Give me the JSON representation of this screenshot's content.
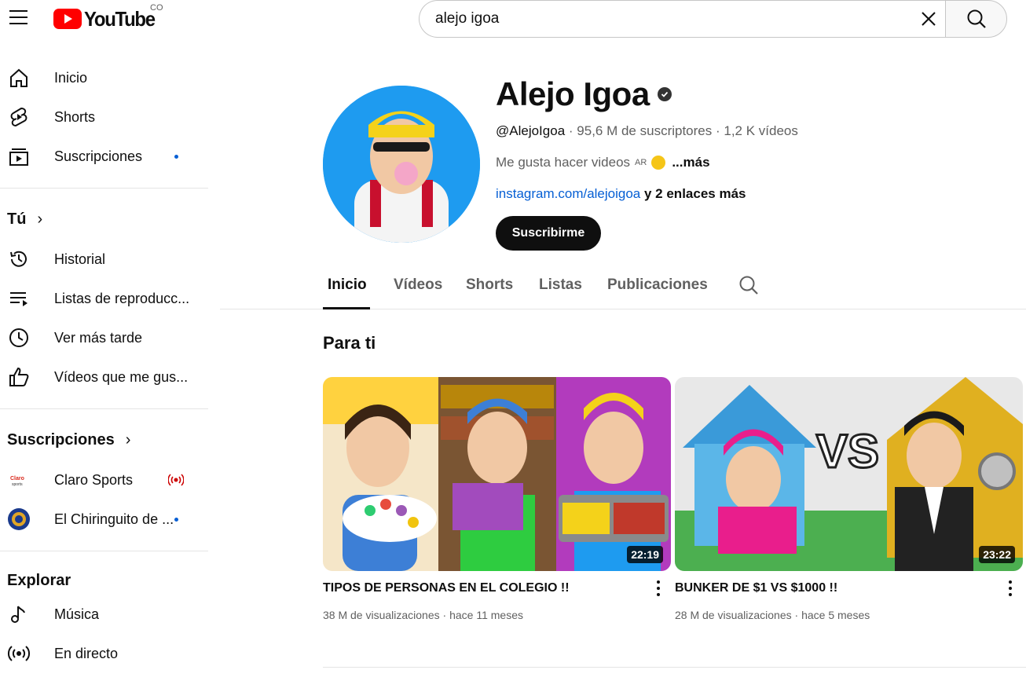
{
  "header": {
    "logo_text": "YouTube",
    "country_code": "CO",
    "search_value": "alejo igoa"
  },
  "sidebar": {
    "main": [
      {
        "label": "Inicio",
        "icon": "home-icon"
      },
      {
        "label": "Shorts",
        "icon": "shorts-icon"
      },
      {
        "label": "Suscripciones",
        "icon": "subscriptions-icon",
        "dot": true
      }
    ],
    "you_header": "Tú",
    "you": [
      {
        "label": "Historial",
        "icon": "history-icon"
      },
      {
        "label": "Listas de reproducc...",
        "icon": "playlists-icon"
      },
      {
        "label": "Ver más tarde",
        "icon": "watch-later-icon"
      },
      {
        "label": "Vídeos que me gus...",
        "icon": "liked-icon"
      }
    ],
    "subs_header": "Suscripciones",
    "subs": [
      {
        "label": "Claro Sports",
        "icon": "claro-sports-avatar",
        "live": true
      },
      {
        "label": "El Chiringuito de ...",
        "icon": "chiringuito-avatar",
        "dot": true
      }
    ],
    "explore_header": "Explorar",
    "explore": [
      {
        "label": "Música",
        "icon": "music-icon"
      },
      {
        "label": "En directo",
        "icon": "live-icon"
      }
    ]
  },
  "channel": {
    "name": "Alejo Igoa",
    "handle": "@AlejoIgoa",
    "subscribers": "95,6 M de suscriptores",
    "videos_count": "1,2 K vídeos",
    "description": "Me gusta hacer videos",
    "description_flag": "AR",
    "description_more": "...más",
    "link": "instagram.com/alejoigoa",
    "more_links": "y 2 enlaces más",
    "subscribe_label": "Suscribirme"
  },
  "tabs": [
    "Inicio",
    "Vídeos",
    "Shorts",
    "Listas",
    "Publicaciones"
  ],
  "active_tab": "Inicio",
  "section_title": "Para ti",
  "videos": [
    {
      "title": "TIPOS DE PERSONAS EN EL COLEGIO !!",
      "views": "38 M de visualizaciones",
      "age": "hace 11 meses",
      "duration": "22:19"
    },
    {
      "title": "BUNKER DE $1 VS $1000 !!",
      "views": "28 M de visualizaciones",
      "age": "hace 5 meses",
      "duration": "23:22"
    }
  ],
  "colors": {
    "brand_red": "#ff0000",
    "link_blue": "#065fd4",
    "text_primary": "#0f0f0f",
    "text_secondary": "#606060",
    "live_red": "#cc0000"
  }
}
